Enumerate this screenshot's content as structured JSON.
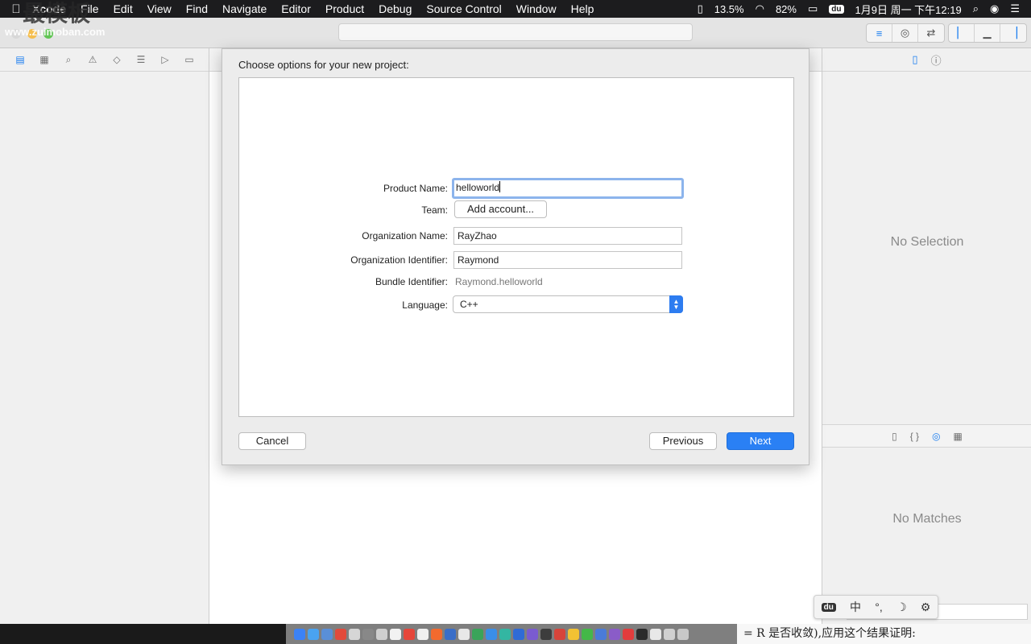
{
  "menubar": {
    "app_name": "Xcode",
    "items": [
      "File",
      "Edit",
      "View",
      "Find",
      "Navigate",
      "Editor",
      "Product",
      "Debug",
      "Source Control",
      "Window",
      "Help"
    ],
    "status": {
      "battery_percent_label": "13.5%",
      "wifi_icon": "wifi-icon",
      "charge_label": "82%",
      "du_label": "du",
      "datetime": "1月9日 周一 下午12:19"
    }
  },
  "watermark": {
    "big": "最模板",
    "url": "www.zuimoban.com"
  },
  "dialog": {
    "title": "Choose options for your new project:",
    "fields": {
      "product_name": {
        "label": "Product Name:",
        "value": "helloworld"
      },
      "team": {
        "label": "Team:",
        "button": "Add account..."
      },
      "org_name": {
        "label": "Organization Name:",
        "value": "RayZhao"
      },
      "org_identifier": {
        "label": "Organization Identifier:",
        "value": "Raymond"
      },
      "bundle_identifier": {
        "label": "Bundle Identifier:",
        "value": "Raymond.helloworld"
      },
      "language": {
        "label": "Language:",
        "value": "C++"
      }
    },
    "buttons": {
      "cancel": "Cancel",
      "previous": "Previous",
      "next": "Next"
    }
  },
  "inspector": {
    "no_selection": "No Selection",
    "no_matches": "No Matches"
  },
  "ime": {
    "du": "du",
    "mode": "中",
    "punct": "°,",
    "moon": "☽",
    "settings": "⚙"
  },
  "bg_text": "= R 是否收敛),应用这个结果证明:",
  "colors": {
    "accent": "#2a80f4",
    "focus_ring": "#8cb4ec",
    "menubar": "#1c1c1e"
  }
}
